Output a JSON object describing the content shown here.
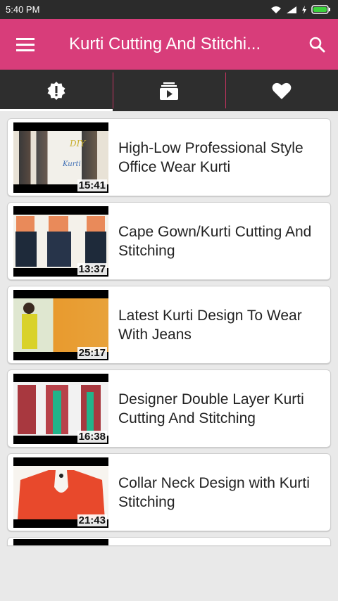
{
  "status_bar": {
    "time": "5:40 PM",
    "icons": [
      "wifi-icon",
      "signal-icon",
      "charging-icon",
      "battery-icon"
    ]
  },
  "app_bar": {
    "title": "Kurti Cutting And Stitchi...",
    "menu_icon": "hamburger-menu-icon",
    "search_icon": "search-icon",
    "color": "#d83d7a"
  },
  "tabs": [
    {
      "icon": "alert-badge-icon",
      "active": true
    },
    {
      "icon": "video-playlist-icon",
      "active": false
    },
    {
      "icon": "heart-icon",
      "active": false
    }
  ],
  "videos": [
    {
      "title": "High-Low Professional Style Office Wear Kurti",
      "duration": "15:41"
    },
    {
      "title": "Cape Gown/Kurti Cutting And Stitching",
      "duration": "13:37"
    },
    {
      "title": "Latest Kurti Design To Wear With Jeans",
      "duration": "25:17"
    },
    {
      "title": "Designer Double Layer Kurti Cutting And Stitching",
      "duration": "16:38"
    },
    {
      "title": "Collar Neck Design with Kurti Stitching",
      "duration": "21:43"
    }
  ]
}
